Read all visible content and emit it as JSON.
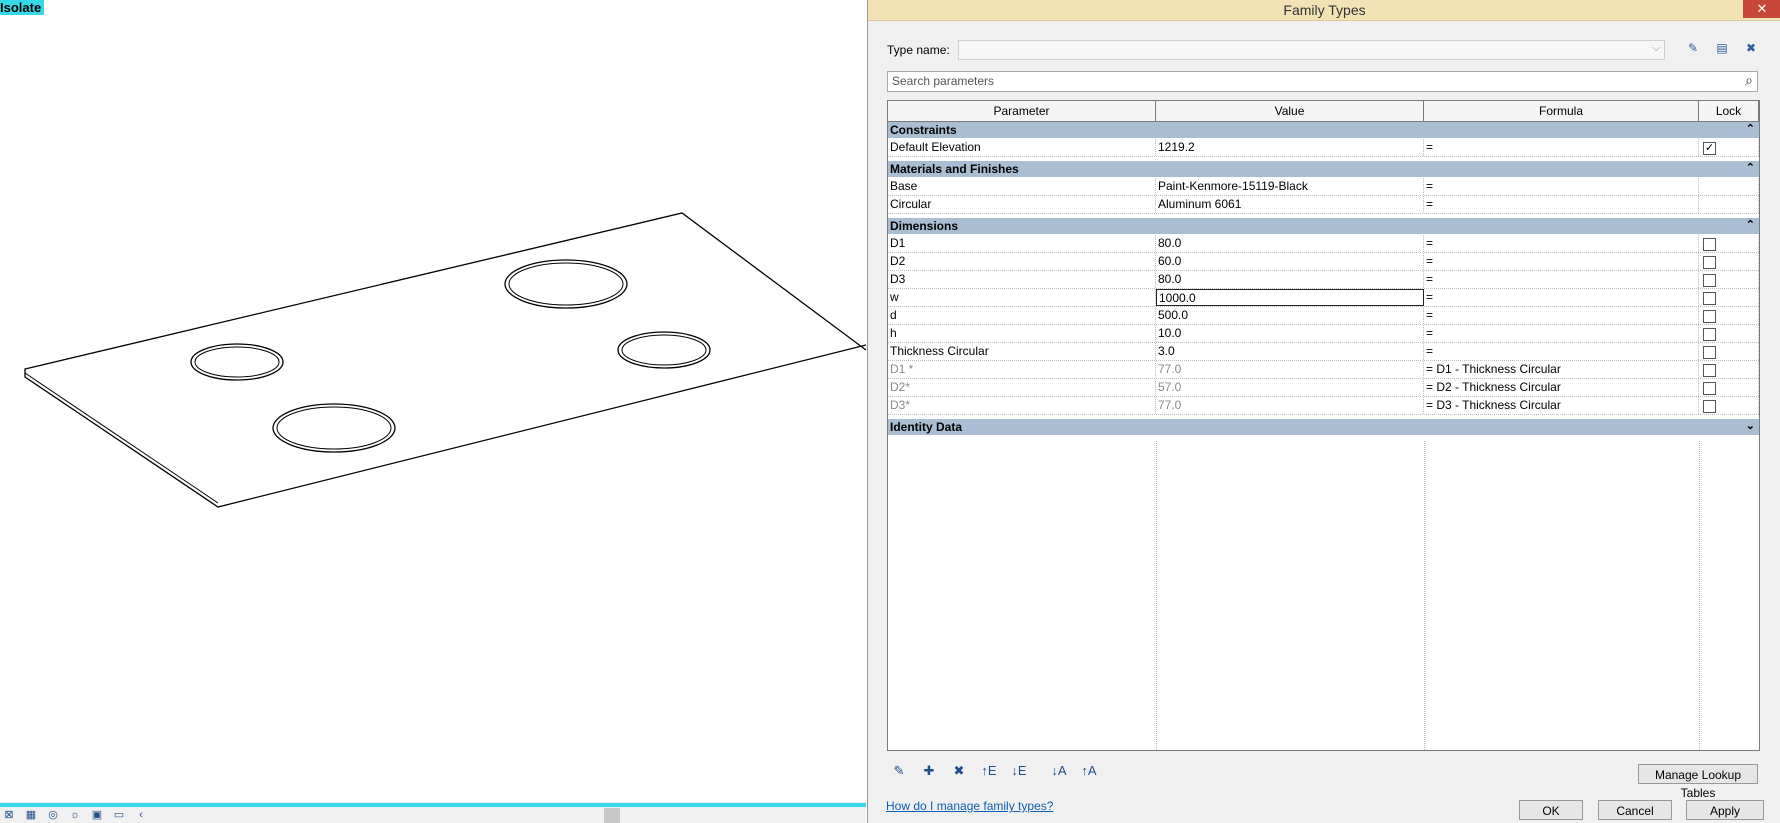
{
  "viewport": {
    "badge": "Isolate"
  },
  "dialog": {
    "title": "Family Types",
    "close_glyph": "✕",
    "type_name_label": "Type name:",
    "type_name_value": "",
    "search_placeholder": "Search parameters",
    "columns": [
      "Parameter",
      "Value",
      "Formula",
      "Lock"
    ],
    "groups": [
      {
        "name": "Constraints",
        "toggle": "⌃",
        "rows": [
          {
            "param": "Default Elevation",
            "value": "1219.2",
            "formula": "=",
            "lock": "checked",
            "dim": false
          }
        ]
      },
      {
        "name": "Materials and Finishes",
        "toggle": "⌃",
        "rows": [
          {
            "param": "Base",
            "value": "Paint-Kenmore-15119-Black",
            "formula": "=",
            "lock": "none",
            "dim": false
          },
          {
            "param": "Circular",
            "value": "Aluminum 6061",
            "formula": "=",
            "lock": "none",
            "dim": false
          }
        ]
      },
      {
        "name": "Dimensions",
        "toggle": "⌃",
        "rows": [
          {
            "param": "D1",
            "value": "80.0",
            "formula": "=",
            "lock": "unchecked",
            "dim": false
          },
          {
            "param": "D2",
            "value": "60.0",
            "formula": "=",
            "lock": "unchecked",
            "dim": false
          },
          {
            "param": "D3",
            "value": "80.0",
            "formula": "=",
            "lock": "unchecked",
            "dim": false
          },
          {
            "param": "w",
            "value": "1000.0",
            "formula": "=",
            "lock": "unchecked",
            "dim": false,
            "editing": true
          },
          {
            "param": "d",
            "value": "500.0",
            "formula": "=",
            "lock": "unchecked",
            "dim": false
          },
          {
            "param": "h",
            "value": "10.0",
            "formula": "=",
            "lock": "unchecked",
            "dim": false
          },
          {
            "param": "Thickness Circular",
            "value": "3.0",
            "formula": "=",
            "lock": "unchecked",
            "dim": false
          },
          {
            "param": "D1 *",
            "value": "77.0",
            "formula": "= D1 - Thickness Circular",
            "lock": "unchecked",
            "dim": true
          },
          {
            "param": "D2*",
            "value": "57.0",
            "formula": "= D2 - Thickness Circular",
            "lock": "unchecked",
            "dim": true
          },
          {
            "param": "D3*",
            "value": "77.0",
            "formula": "= D3 - Thickness Circular",
            "lock": "unchecked",
            "dim": true
          }
        ]
      },
      {
        "name": "Identity Data",
        "toggle": "⌄",
        "rows": []
      }
    ],
    "manage_lookup_label": "Manage Lookup Tables",
    "help_link": "How do I manage family types?",
    "ok_label": "OK",
    "cancel_label": "Cancel",
    "apply_label": "Apply"
  }
}
